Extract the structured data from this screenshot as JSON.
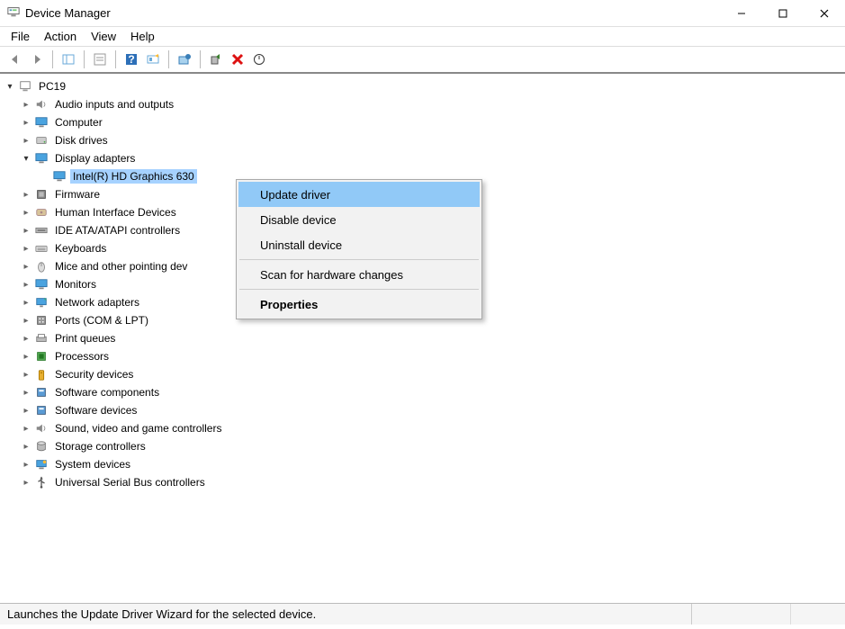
{
  "window": {
    "title": "Device Manager"
  },
  "menu": {
    "file": "File",
    "action": "Action",
    "view": "View",
    "help": "Help"
  },
  "tree": {
    "root": "PC19",
    "categories": [
      {
        "label": "Audio inputs and outputs",
        "icon": "speaker"
      },
      {
        "label": "Computer",
        "icon": "monitor"
      },
      {
        "label": "Disk drives",
        "icon": "disk"
      },
      {
        "label": "Display adapters",
        "icon": "monitor",
        "expanded": true,
        "children": [
          {
            "label": "Intel(R) HD Graphics 630",
            "icon": "monitor",
            "selected": true
          }
        ]
      },
      {
        "label": "Firmware",
        "icon": "chip"
      },
      {
        "label": "Human Interface Devices",
        "icon": "hid"
      },
      {
        "label": "IDE ATA/ATAPI controllers",
        "icon": "ide"
      },
      {
        "label": "Keyboards",
        "icon": "keyboard"
      },
      {
        "label": "Mice and other pointing devices",
        "icon": "mouse",
        "truncated": true
      },
      {
        "label": "Monitors",
        "icon": "monitor"
      },
      {
        "label": "Network adapters",
        "icon": "network"
      },
      {
        "label": "Ports (COM & LPT)",
        "icon": "port"
      },
      {
        "label": "Print queues",
        "icon": "printer"
      },
      {
        "label": "Processors",
        "icon": "cpu"
      },
      {
        "label": "Security devices",
        "icon": "security"
      },
      {
        "label": "Software components",
        "icon": "software"
      },
      {
        "label": "Software devices",
        "icon": "software"
      },
      {
        "label": "Sound, video and game controllers",
        "icon": "speaker"
      },
      {
        "label": "Storage controllers",
        "icon": "storage"
      },
      {
        "label": "System devices",
        "icon": "system"
      },
      {
        "label": "Universal Serial Bus controllers",
        "icon": "usb"
      }
    ]
  },
  "context_menu": {
    "items": [
      {
        "label": "Update driver",
        "highlight": true
      },
      {
        "label": "Disable device"
      },
      {
        "label": "Uninstall device"
      },
      {
        "sep": true
      },
      {
        "label": "Scan for hardware changes"
      },
      {
        "sep": true
      },
      {
        "label": "Properties",
        "bold": true
      }
    ]
  },
  "statusbar": {
    "text": "Launches the Update Driver Wizard for the selected device."
  }
}
